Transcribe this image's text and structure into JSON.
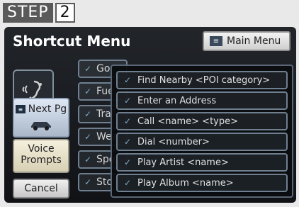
{
  "step": {
    "label": "STEP",
    "number": "2"
  },
  "title": "Shortcut Menu",
  "main_menu": {
    "label": "Main Menu",
    "icon": "list-icon"
  },
  "left_panel": {
    "voice_icon": "voice-icon",
    "next_label": "Next Pg",
    "voice_label": "Voice Prompts",
    "cancel_label": "Cancel"
  },
  "background_items": [
    {
      "label": "Go"
    },
    {
      "label": "Fue"
    },
    {
      "label": "Traf"
    },
    {
      "label": "Wea"
    },
    {
      "label": "Spo"
    },
    {
      "label": "Sto"
    }
  ],
  "dropdown": {
    "items": [
      {
        "label": "Find Nearby <POI category>"
      },
      {
        "label": "Enter an Address"
      },
      {
        "label": "Call <name> <type>"
      },
      {
        "label": "Dial <number>"
      },
      {
        "label": "Play Artist <name>"
      },
      {
        "label": "Play Album <name>"
      }
    ]
  },
  "colors": {
    "accent_blue": "#7fa9c7"
  }
}
